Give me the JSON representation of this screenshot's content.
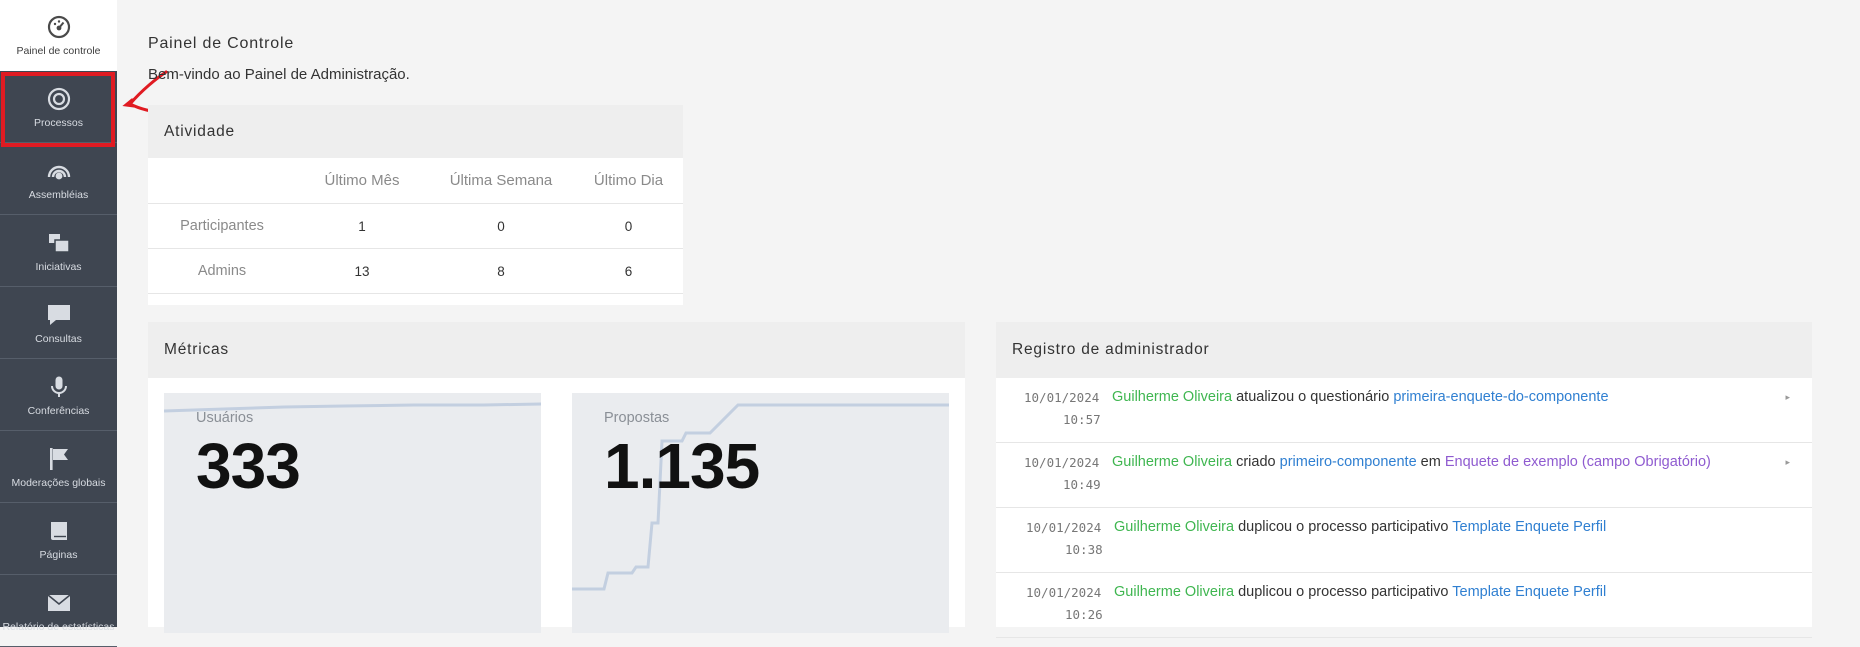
{
  "sidebar": {
    "items": [
      {
        "label": "Painel de controle",
        "icon": "dashboard-icon"
      },
      {
        "label": "Processos",
        "icon": "target-icon"
      },
      {
        "label": "Assembléias",
        "icon": "assembly-icon"
      },
      {
        "label": "Iniciativas",
        "icon": "initiatives-icon"
      },
      {
        "label": "Consultas",
        "icon": "chat-bubble-icon"
      },
      {
        "label": "Conferências",
        "icon": "microphone-icon"
      },
      {
        "label": "Moderações globais",
        "icon": "flag-icon"
      },
      {
        "label": "Páginas",
        "icon": "book-icon"
      },
      {
        "label": "Relatório de estatísticas",
        "icon": "envelope-icon"
      }
    ]
  },
  "header": {
    "title": "Painel de Controle",
    "welcome": "Bem-vindo ao Painel de Administração."
  },
  "activity": {
    "title": "Atividade",
    "columns": [
      "",
      "Último Mês",
      "Última Semana",
      "Último Dia"
    ],
    "rows": [
      {
        "label": "Participantes",
        "values": [
          "1",
          "0",
          "0"
        ]
      },
      {
        "label": "Admins",
        "values": [
          "13",
          "8",
          "6"
        ]
      }
    ]
  },
  "metrics": {
    "title": "Métricas",
    "tiles": [
      {
        "label": "Usuários",
        "value": "333"
      },
      {
        "label": "Propostas",
        "value": "1.135"
      }
    ]
  },
  "admin_log": {
    "title": "Registro de administrador",
    "entries": [
      {
        "date": "10/01/2024",
        "time": "10:57",
        "user": "Guilherme Oliveira",
        "action": " atualizou o questionário ",
        "target": "primeira-enquete-do-componente",
        "mid": "",
        "target2": ""
      },
      {
        "date": "10/01/2024",
        "time": "10:49",
        "user": "Guilherme Oliveira",
        "action": " criado ",
        "target": "primeiro-componente",
        "mid": " em ",
        "target2": "Enquete de exemplo (campo Obrigatório)"
      },
      {
        "date": "10/01/2024",
        "time": "10:38",
        "user": "Guilherme Oliveira",
        "action": " duplicou o processo participativo ",
        "target": "Template Enquete Perfil",
        "mid": "",
        "target2": ""
      },
      {
        "date": "10/01/2024",
        "time": "10:26",
        "user": "Guilherme Oliveira",
        "action": " duplicou o processo participativo ",
        "target": "Template Enquete Perfil",
        "mid": "",
        "target2": ""
      }
    ]
  },
  "colors": {
    "sidebar_bg": "#3f4651",
    "highlight": "#e01b22",
    "user_link": "#3fb650",
    "resource_link": "#2f7fd1",
    "space_link": "#8f5bd0",
    "chart_line": "#c3cfe0"
  }
}
